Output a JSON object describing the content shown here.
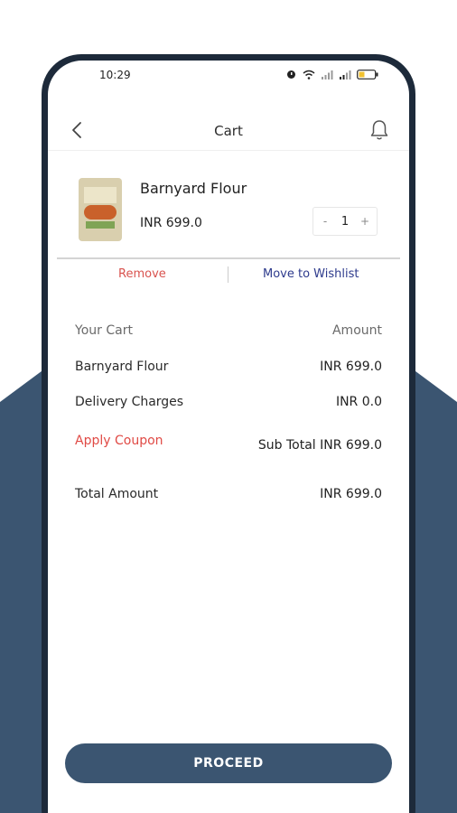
{
  "status_bar": {
    "time": "10:29",
    "icons": [
      "alarm-icon",
      "wifi-icon",
      "signal-icon",
      "signal-icon",
      "battery-icon"
    ]
  },
  "app_bar": {
    "title": "Cart",
    "back_icon": "chevron-left-icon",
    "notification_icon": "bell-icon"
  },
  "cart_item": {
    "name": "Barnyard Flour",
    "price": "INR 699.0",
    "quantity": "1",
    "decrement_label": "-",
    "increment_label": "+",
    "remove_label": "Remove",
    "wishlist_label": "Move to Wishlist"
  },
  "summary": {
    "header_label": "Your Cart",
    "header_value": "Amount",
    "item_label": "Barnyard Flour",
    "item_value": "INR 699.0",
    "delivery_label": "Delivery Charges",
    "delivery_value": "INR 0.0",
    "coupon_label": "Apply Coupon",
    "subtotal_value": "Sub Total INR 699.0",
    "total_label": "Total Amount",
    "total_value": "INR 699.0"
  },
  "proceed_label": "PROCEED",
  "colors": {
    "brand": "#3b5571",
    "remove": "#d9534f",
    "wishlist": "#2d3a8c",
    "coupon": "#e04a45"
  }
}
